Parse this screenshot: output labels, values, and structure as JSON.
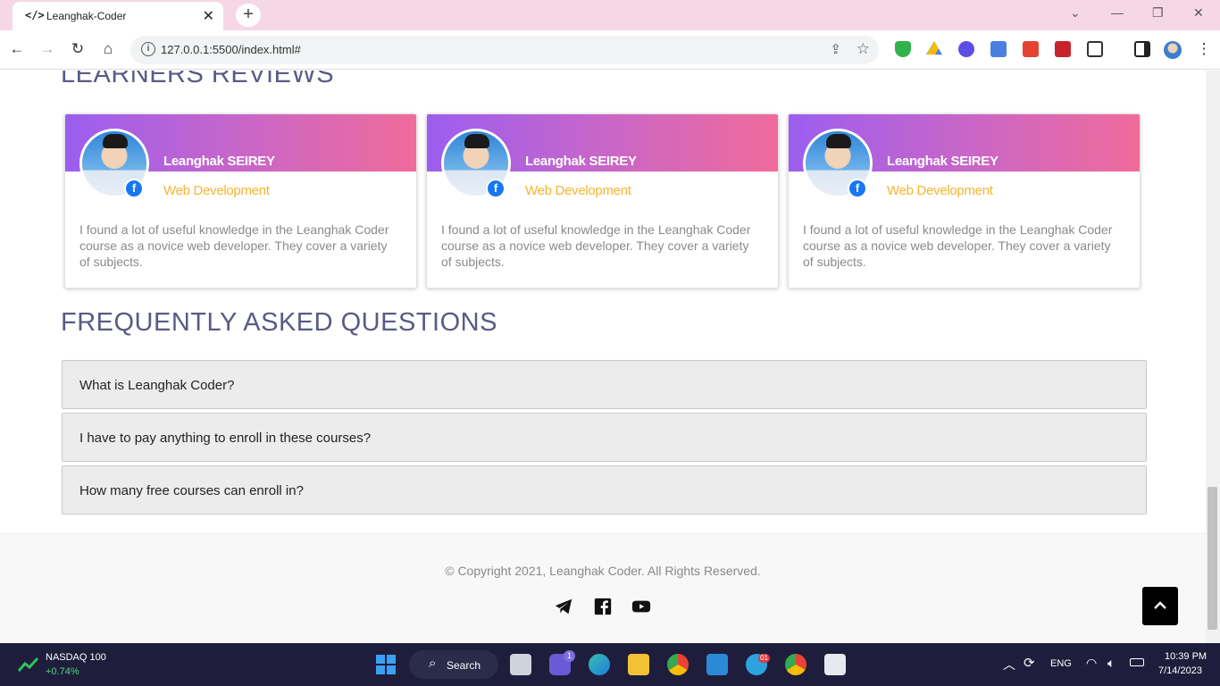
{
  "browser": {
    "tab_title": "Leanghak-Coder",
    "tab_icon": "</>",
    "url": "127.0.0.1:5500/index.html#"
  },
  "reviews": {
    "section_title": "LEARNERS REVIEWS",
    "items": [
      {
        "name": "Leanghak SEIREY",
        "role": "Web Development",
        "text": "I found a lot of useful knowledge in the Leanghak Coder course as a novice web developer. They cover a variety of subjects."
      },
      {
        "name": "Leanghak SEIREY",
        "role": "Web Development",
        "text": "I found a lot of useful knowledge in the Leanghak Coder course as a novice web developer. They cover a variety of subjects."
      },
      {
        "name": "Leanghak SEIREY",
        "role": "Web Development",
        "text": "I found a lot of useful knowledge in the Leanghak Coder course as a novice web developer. They cover a variety of subjects."
      }
    ]
  },
  "faq": {
    "section_title": "FREQUENTLY ASKED QUESTIONS",
    "items": [
      {
        "question": "What is Leanghak Coder?"
      },
      {
        "question": "I have to pay anything to enroll in these courses?"
      },
      {
        "question": "How many free courses can enroll in?"
      }
    ]
  },
  "footer": {
    "copyright": "© Copyright 2021, Leanghak Coder. All Rights Reserved.",
    "social": [
      "telegram-icon",
      "facebook-icon",
      "youtube-icon"
    ]
  },
  "taskbar": {
    "stock_name": "NASDAQ 100",
    "stock_change": "+0.74%",
    "search_label": "Search",
    "language": "ENG",
    "time": "10:39 PM",
    "date": "7/14/2023",
    "teams_badge": "1",
    "telegram_badge": "01"
  },
  "colors": {
    "accent_gradient_start": "#9b5ef0",
    "accent_gradient_end": "#f06b9a",
    "role_color": "#f5b52f",
    "title_color": "#5a5a85"
  }
}
